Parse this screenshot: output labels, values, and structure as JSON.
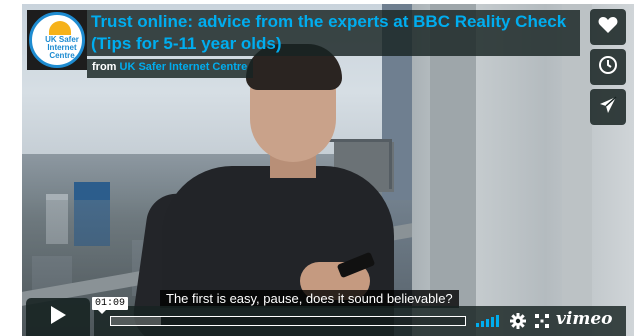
{
  "video": {
    "title": "Trust online: advice from the experts at BBC Reality Check (Tips for 5-11 year olds)",
    "byline_prefix": "from",
    "owner": "UK Safer Internet Centre",
    "subtitle": "The first is easy, pause, does it sound believable?"
  },
  "logo": {
    "text_line1": "UK Safer",
    "text_line2": "Internet",
    "text_line3": "Centre"
  },
  "side_buttons": [
    {
      "name": "like-button",
      "icon": "heart-icon"
    },
    {
      "name": "watch-later-button",
      "icon": "clock-icon"
    },
    {
      "name": "share-button",
      "icon": "paper-plane-icon"
    }
  ],
  "controls": {
    "time_display": "01:09",
    "play_icon": "play-icon",
    "settings_icon": "gear-icon",
    "fullscreen_icon": "fullscreen-icon",
    "brand": "vimeo",
    "volume_icon": "volume-bars-icon"
  },
  "colors": {
    "accent": "#00adef",
    "overlay": "#172322",
    "logo_blue": "#1e8cd1",
    "logo_sun": "#f6b21a"
  }
}
